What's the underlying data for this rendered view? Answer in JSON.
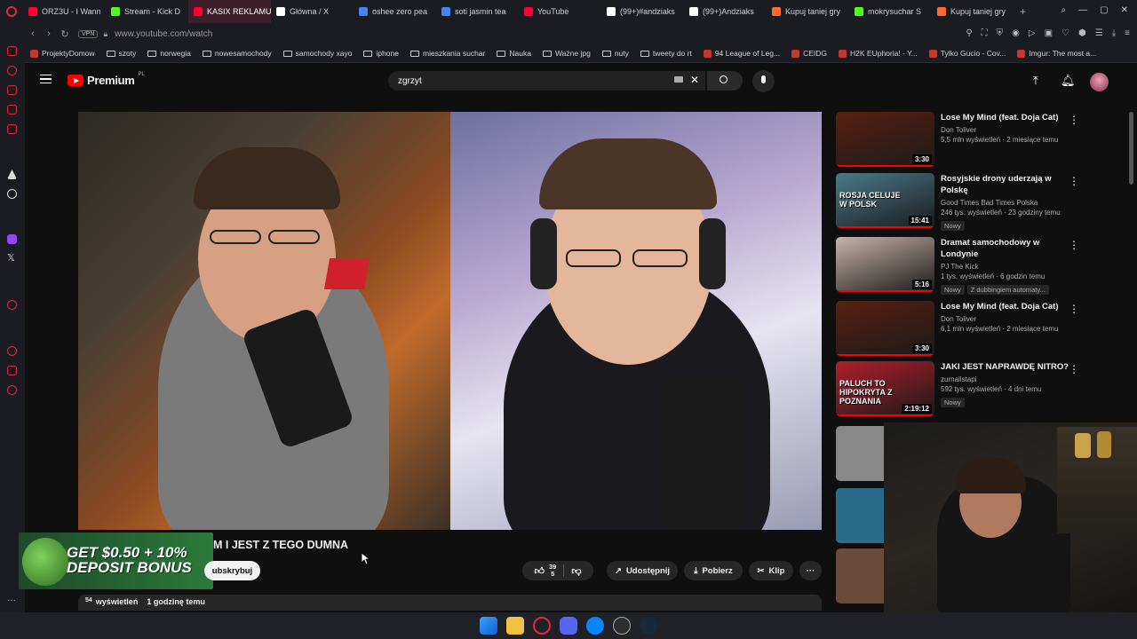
{
  "browser": {
    "tabs": [
      {
        "label": "ORZ3U - I Wann",
        "color": "#ff0033"
      },
      {
        "label": "Stream - Kick D",
        "color": "#53fc18"
      },
      {
        "label": "KASIX REKLAMUJE S",
        "color": "#ff0033",
        "active": true
      },
      {
        "label": "Główna / X",
        "color": "#ffffff"
      },
      {
        "label": "oshee zero pea",
        "color": "#4285f4"
      },
      {
        "label": "soti jasmin tea",
        "color": "#4285f4"
      },
      {
        "label": "YouTube",
        "color": "#ff0033"
      },
      {
        "label": "(99+)#andziaks",
        "color": "#ffffff"
      },
      {
        "label": "(99+)Andziaks",
        "color": "#ffffff"
      },
      {
        "label": "Kupuj taniej gry",
        "color": "#ff6a2a"
      },
      {
        "label": "mokrysuchar S",
        "color": "#53fc18"
      },
      {
        "label": "Kupuj taniej gry",
        "color": "#ff6a2a"
      }
    ],
    "url": "www.youtube.com/watch",
    "vpn_label": "VPN",
    "bookmarks": [
      {
        "label": "ProjektyDomow",
        "type": "page"
      },
      {
        "label": "szoty",
        "type": "folder"
      },
      {
        "label": "norwegia",
        "type": "folder"
      },
      {
        "label": "nowesamochody",
        "type": "folder"
      },
      {
        "label": "samochody xayo",
        "type": "folder"
      },
      {
        "label": "iphone",
        "type": "folder"
      },
      {
        "label": "mieszkania suchar",
        "type": "folder"
      },
      {
        "label": "Nauka",
        "type": "folder"
      },
      {
        "label": "Ważne jpg",
        "type": "folder"
      },
      {
        "label": "nuty",
        "type": "folder"
      },
      {
        "label": "tweety do rt",
        "type": "folder"
      },
      {
        "label": "94 League of Leg...",
        "type": "page"
      },
      {
        "label": "CEIDG",
        "type": "page"
      },
      {
        "label": "H2K EUphoria! - Y...",
        "type": "page"
      },
      {
        "label": "Tylko Gucio - Cov...",
        "type": "page"
      },
      {
        "label": "Imgur: The most a...",
        "type": "page"
      }
    ]
  },
  "youtube": {
    "logo_label": "Premium",
    "logo_region": "PL",
    "search_value": "zgrzyt",
    "video": {
      "title": "M I JEST Z TEGO DUMNA",
      "subscribe_label": "ubskrybuj",
      "likes": "39",
      "dislikes": "5",
      "share_label": "Udostępnij",
      "download_label": "Pobierz",
      "clip_label": "Klip",
      "views_prefix": "54",
      "views_label": "wyświetleń",
      "time_ago": "1 godzinę temu"
    },
    "ad_text": "GET $0.50 + 10% DEPOSIT BONUS",
    "recommendations": [
      {
        "title": "Lose My Mind (feat. Doja Cat)",
        "channel": "Don Toliver",
        "meta": "5,5 mln wyświetleń · 2 miesiące temu",
        "duration": "3:30",
        "badges": [],
        "thumb": "#5a2010"
      },
      {
        "title": "Rosyjskie drony uderzają w Polskę",
        "channel": "Good Times Bad Times Polska",
        "meta": "246 tys. wyświetleń · 23 godziny temu",
        "duration": "15:41",
        "badges": [
          "Nowy"
        ],
        "thumb": "#4a7a8a",
        "thumb_text": "ROSJA CELUJE W POLSK"
      },
      {
        "title": "Dramat samochodowy w Londynie",
        "channel": "PJ The Kick",
        "meta": "1 tys. wyświetleń · 6 godzin temu",
        "duration": "5:16",
        "badges": [
          "Nowy",
          "Z dubbingiem automaty..."
        ],
        "thumb": "#c7b3a8"
      },
      {
        "title": "Lose My Mind (feat. Doja Cat)",
        "channel": "Don Toliver",
        "meta": "6,1 mln wyświetleń · 2 miesiące temu",
        "duration": "3:30",
        "badges": [],
        "thumb": "#5a2010"
      },
      {
        "title": "JAKI JEST NAPRAWDĘ NITRO?",
        "channel": "zurnalistapi",
        "meta": "592 tys. wyświetleń · 4 dni temu",
        "duration": "2:19:12",
        "badges": [
          "Nowy"
        ],
        "thumb": "#b11e2a",
        "thumb_text": "PALUCH TO HIPOKRYTA Z POZNANIA"
      }
    ]
  }
}
